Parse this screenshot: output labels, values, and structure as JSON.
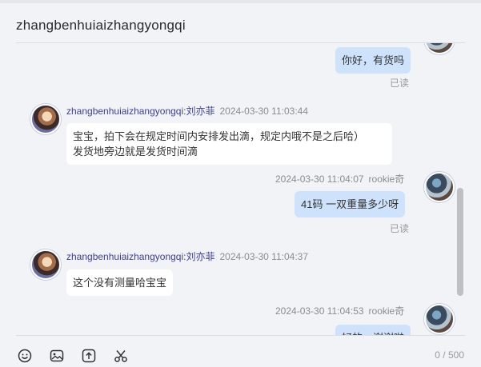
{
  "window": {
    "title": "zhangbenhuiaizhangyongqi"
  },
  "messages": [
    {
      "side": "self",
      "text": "你好，有货吗",
      "status": "已读"
    },
    {
      "side": "other",
      "sender": "zhangbenhuiaizhangyongqi:刘亦菲",
      "time": "2024-03-30 11:03:44",
      "lines": [
        "宝宝，拍下会在规定时间内安排发出滴，规定内哦不是之后哈）",
        "发货地旁边就是发货时间滴"
      ]
    },
    {
      "side": "self",
      "sender": "rookie奇",
      "time": "2024-03-30 11:04:07",
      "text": "41码 一双重量多少呀",
      "status": "已读"
    },
    {
      "side": "other",
      "sender": "zhangbenhuiaizhangyongqi:刘亦菲",
      "time": "2024-03-30 11:04:37",
      "text": "这个没有测量哈宝宝"
    },
    {
      "side": "self",
      "sender": "rookie奇",
      "time": "2024-03-30 11:04:53",
      "text": "好的，谢谢啦"
    }
  ],
  "input": {
    "counter": "0 / 500"
  },
  "toolbar": [
    "emoji-icon",
    "image-icon",
    "upload-icon",
    "scissors-icon"
  ]
}
